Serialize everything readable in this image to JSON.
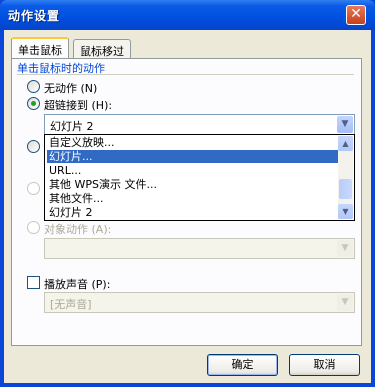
{
  "window": {
    "title": "动作设置",
    "close": "✕"
  },
  "tabs": [
    {
      "label": "单击鼠标",
      "active": true
    },
    {
      "label": "鼠标移过",
      "active": false
    }
  ],
  "group": {
    "title": "单击鼠标时的动作"
  },
  "options": {
    "none": {
      "label": "无动作",
      "accel": "(N)"
    },
    "hyperlink": {
      "label": "超链接到",
      "accel": "(H):",
      "selected": true,
      "value": "幻灯片 2"
    },
    "object_action": {
      "label": "对象动作",
      "accel": "(A):"
    }
  },
  "dropdown_items": [
    {
      "label": "自定义放映..."
    },
    {
      "label": "幻灯片...",
      "selected": true
    },
    {
      "label": "URL..."
    },
    {
      "label": "其他 WPS演示 文件..."
    },
    {
      "label": "其他文件..."
    },
    {
      "label": "幻灯片 2"
    }
  ],
  "sound": {
    "label": "播放声音",
    "accel": "(P):",
    "value": "[无声音]"
  },
  "buttons": {
    "ok": "确定",
    "cancel": "取消"
  },
  "icons": {
    "dropdown_arrow": "▼",
    "scroll_up": "▲",
    "scroll_down": "▼"
  },
  "colors": {
    "titlebar": "#0050e0",
    "selection": "#316ac5",
    "group_title": "#0046d5"
  }
}
